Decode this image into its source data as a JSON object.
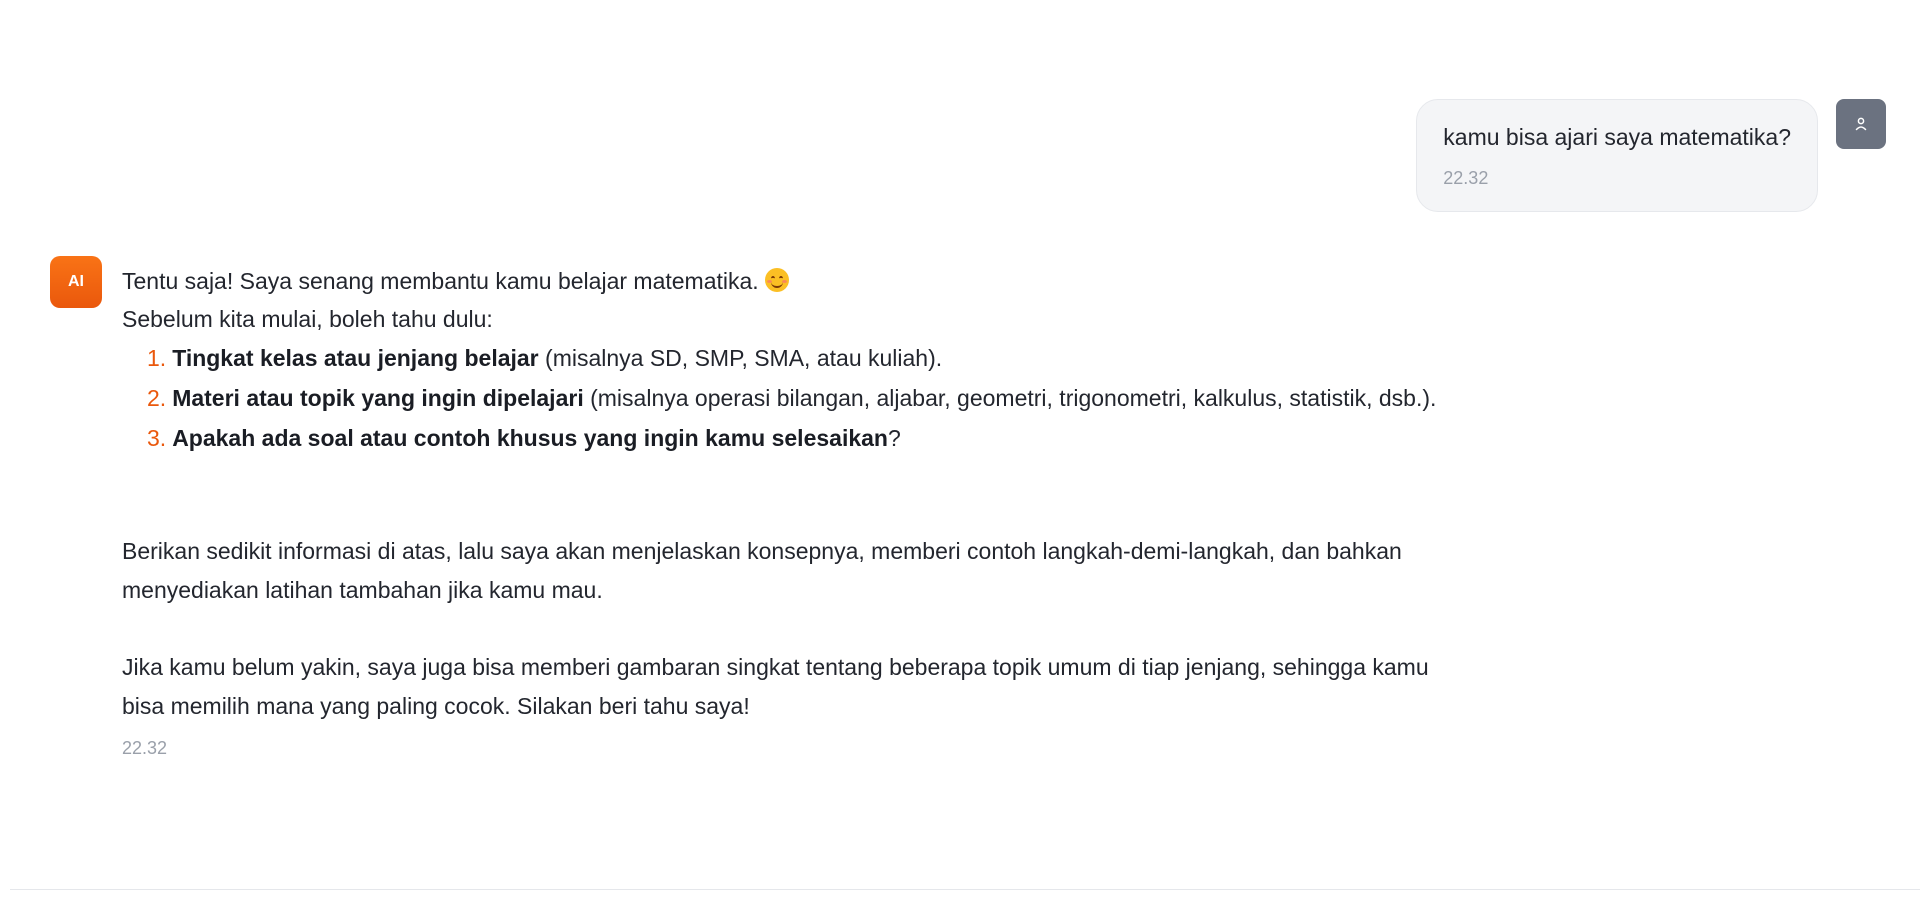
{
  "user_message": {
    "text": "kamu bisa ajari saya matematika?",
    "time": "22.32",
    "avatar_icon": "user-icon"
  },
  "assistant_message": {
    "avatar_label": "AI",
    "greeting": "Tentu saja! Saya senang membantu kamu belajar matematika.",
    "emoji_icon": "smiling-face-emoji-icon",
    "intro": "Sebelum kita mulai, boleh tahu dulu:",
    "list": [
      {
        "number": "1.",
        "bold": "Tingkat kelas atau jenjang belajar",
        "rest": " (misalnya SD, SMP, SMA, atau kuliah)."
      },
      {
        "number": "2.",
        "bold": "Materi atau topik yang ingin dipelajari",
        "rest": " (misalnya operasi bilangan, aljabar, geometri, trigonometri, kalkulus, statistik, dsb.)."
      },
      {
        "number": "3.",
        "bold": "Apakah ada soal atau contoh khusus yang ingin kamu selesaikan",
        "rest": "?"
      }
    ],
    "paragraph1": "Berikan sedikit informasi di atas, lalu saya akan menjelaskan konsepnya, memberi contoh langkah-demi-langkah, dan bahkan menyediakan latihan tambahan jika kamu mau.",
    "paragraph2": "Jika kamu belum yakin, saya juga bisa memberi gambaran singkat tentang beberapa topik umum di tiap jenjang, sehingga kamu bisa memilih mana yang paling cocok. Silakan beri tahu saya!",
    "time": "22.32"
  },
  "colors": {
    "accent": "#ea580c",
    "user_bubble": "#f4f5f7",
    "user_avatar": "#6b7280"
  }
}
